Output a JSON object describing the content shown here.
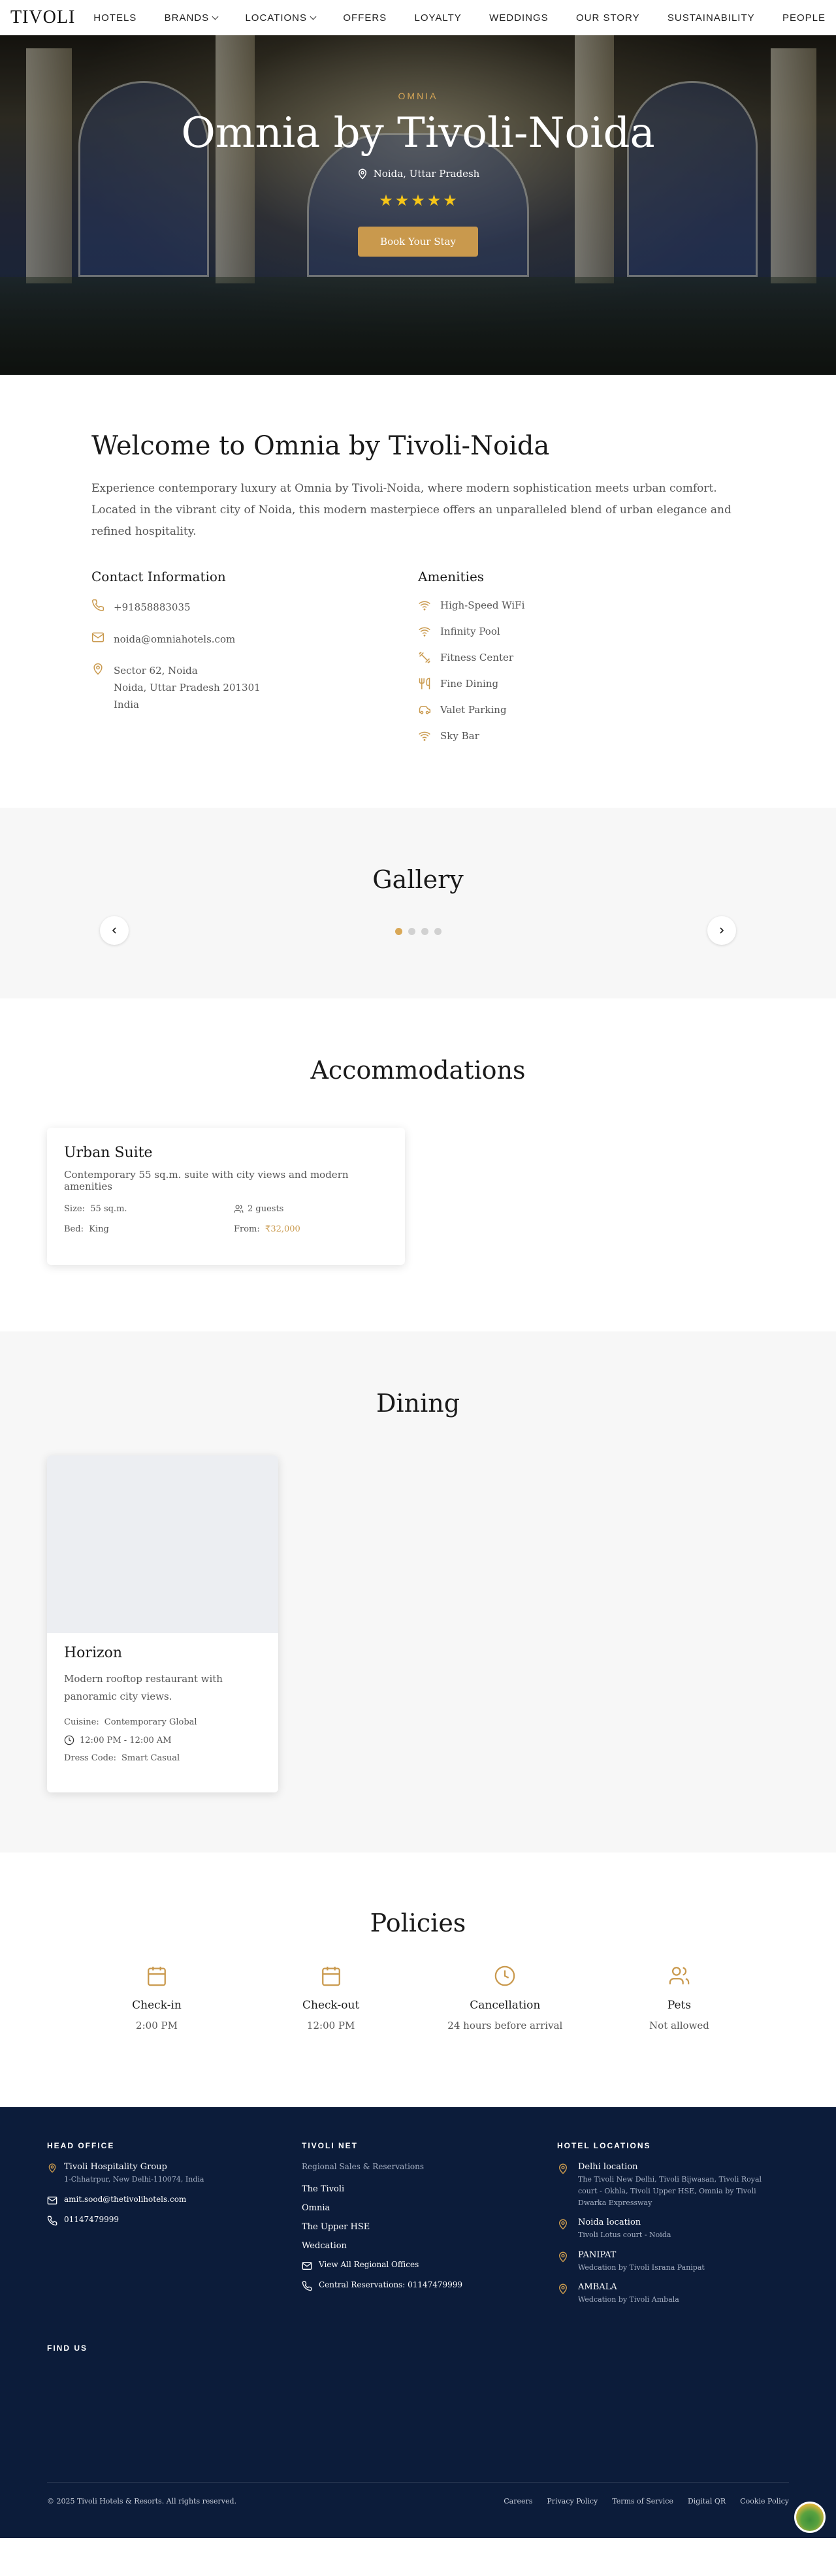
{
  "nav": {
    "logo": "TIVOLI",
    "items": [
      {
        "label": "HOTELS"
      },
      {
        "label": "BRANDS"
      },
      {
        "label": "LOCATIONS"
      },
      {
        "label": "OFFERS"
      },
      {
        "label": "LOYALTY"
      },
      {
        "label": "WEDDINGS"
      },
      {
        "label": "OUR STORY"
      },
      {
        "label": "SUSTAINABILITY"
      },
      {
        "label": "PEOPLE"
      }
    ]
  },
  "hero": {
    "eyebrow": "OMNIA",
    "title": "Omnia by Tivoli-Noida",
    "location": "Noida, Uttar Pradesh",
    "rating": 5,
    "cta": "Book Your Stay"
  },
  "welcome": {
    "title": "Welcome to Omnia by Tivoli-Noida",
    "intro": "Experience contemporary luxury at Omnia by Tivoli-Noida, where modern sophistication meets urban comfort. Located in the vibrant city of Noida, this modern masterpiece offers an unparalleled blend of urban elegance and refined hospitality."
  },
  "contact": {
    "title": "Contact Information",
    "phone": "+91858883035",
    "email": "noida@omniahotels.com",
    "address_line1": "Sector 62, Noida",
    "address_line2": "Noida, Uttar Pradesh 201301",
    "address_line3": "India"
  },
  "amenities": {
    "title": "Amenities",
    "items": [
      {
        "label": "High-Speed WiFi",
        "icon": "wifi-icon"
      },
      {
        "label": "Infinity Pool",
        "icon": "wifi-icon"
      },
      {
        "label": "Fitness Center",
        "icon": "dumbbell-icon"
      },
      {
        "label": "Fine Dining",
        "icon": "utensils-icon"
      },
      {
        "label": "Valet Parking",
        "icon": "car-icon"
      },
      {
        "label": "Sky Bar",
        "icon": "wifi-icon"
      }
    ]
  },
  "gallery": {
    "title": "Gallery",
    "slide_count": 4,
    "active_index": 0
  },
  "accommodations": {
    "title": "Accommodations",
    "rooms": [
      {
        "name": "Urban Suite",
        "description": "Contemporary 55 sq.m. suite with city views and modern amenities",
        "size_label": "Size:",
        "size": "55 sq.m.",
        "guests": "2 guests",
        "bed_label": "Bed:",
        "bed": "King",
        "price_label": "From:",
        "price": "₹32,000"
      }
    ]
  },
  "dining": {
    "title": "Dining",
    "restaurants": [
      {
        "name": "Horizon",
        "description": "Modern rooftop restaurant with panoramic city views.",
        "cuisine_label": "Cuisine:",
        "cuisine": "Contemporary Global",
        "hours": "12:00 PM - 12:00 AM",
        "dress_label": "Dress Code:",
        "dress": "Smart Casual"
      }
    ]
  },
  "policies": {
    "title": "Policies",
    "items": [
      {
        "title": "Check-in",
        "value": "2:00 PM",
        "icon": "calendar-icon"
      },
      {
        "title": "Check-out",
        "value": "12:00 PM",
        "icon": "calendar-icon"
      },
      {
        "title": "Cancellation",
        "value": "24 hours before arrival",
        "icon": "clock-icon"
      },
      {
        "title": "Pets",
        "value": "Not allowed",
        "icon": "users-icon"
      }
    ]
  },
  "footer": {
    "head_office": {
      "heading": "HEAD OFFICE",
      "company": "Tivoli Hospitality Group",
      "address": "1-Chhatrpur, New Delhi-110074, India",
      "email": "amit.sood@thetivolihotels.com",
      "phone": "01147479999"
    },
    "tivoli_net": {
      "heading": "TIVOLI NET",
      "subtitle": "Regional Sales & Reservations",
      "links": [
        "The Tivoli",
        "Omnia",
        "The Upper HSE",
        "Wedcation"
      ],
      "regional": "View All Regional Offices",
      "central": "Central Reservations: 01147479999"
    },
    "hotel_locations": {
      "heading": "HOTEL LOCATIONS",
      "items": [
        {
          "title": "Delhi location",
          "detail": "The Tivoli New Delhi, Tivoli Bijwasan, Tivoli Royal court - Okhla, Tivoli Upper HSE, Omnia by Tivoli Dwarka Expressway"
        },
        {
          "title": "Noida location",
          "detail": "Tivoli Lotus court - Noida"
        },
        {
          "title": "PANIPAT",
          "detail": "Wedcation by Tivoli Israna Panipat"
        },
        {
          "title": "AMBALA",
          "detail": "Wedcation by Tivoli Ambala"
        }
      ]
    },
    "find_us": "FIND US",
    "copyright": "© 2025 Tivoli Hotels & Resorts. All rights reserved.",
    "legal": [
      "Careers",
      "Privacy Policy",
      "Terms of Service",
      "Digital QR",
      "Cookie Policy"
    ]
  },
  "colors": {
    "accent": "#c9994d",
    "footer_bg": "#0c1c3a",
    "section_alt_bg": "#f7f7f7",
    "star": "#f5c518"
  }
}
